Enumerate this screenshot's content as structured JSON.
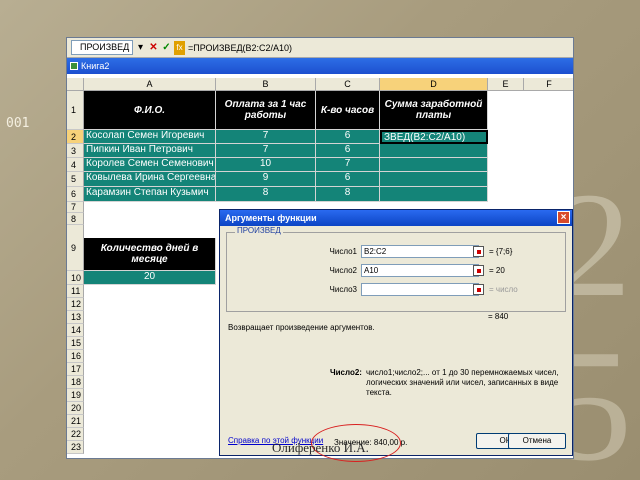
{
  "slide": {
    "number": "001",
    "author": "Олиференко И.А."
  },
  "formula_bar": {
    "name_box": "ПРОИЗВЕД",
    "cancel_icon": "x-icon",
    "enter_icon": "check-icon",
    "fx_icon": "fx-icon",
    "formula": "=ПРОИЗВЕД(B2:C2/A10)"
  },
  "workbook": {
    "title": "Книга2"
  },
  "columns": [
    "A",
    "B",
    "C",
    "D",
    "E",
    "F"
  ],
  "rows": [
    "1",
    "2",
    "3",
    "4",
    "5",
    "6",
    "7",
    "8",
    "9",
    "10",
    "11",
    "12",
    "13",
    "14",
    "15",
    "16",
    "17",
    "18",
    "19",
    "20",
    "21",
    "22",
    "23"
  ],
  "table": {
    "headers": [
      "Ф.И.О.",
      "Оплата за 1 час работы",
      "К-во часов",
      "Сумма заработной платы"
    ],
    "records": [
      {
        "name": "Косолап Семен Игоревич",
        "rate": "7",
        "hours": "6"
      },
      {
        "name": "Пипкин Иван Петрович",
        "rate": "7",
        "hours": "6"
      },
      {
        "name": "Королев Семен Семенович",
        "rate": "10",
        "hours": "7"
      },
      {
        "name": "Ковылева Ирина Сергеевна",
        "rate": "9",
        "hours": "6"
      },
      {
        "name": "Карамзин Степан Кузьмич",
        "rate": "8",
        "hours": "8"
      }
    ],
    "active_cell_text": "ЗВЕД(B2:C2/A10)",
    "days_header": "Количество дней в месяце",
    "days_value": "20"
  },
  "dialog": {
    "title": "Аргументы функции",
    "group_label": "ПРОИЗВЕД",
    "args": [
      {
        "label": "Число1",
        "value": "B2:C2",
        "result": "= {7;6}"
      },
      {
        "label": "Число2",
        "value": "A10",
        "result": "= 20"
      },
      {
        "label": "Число3",
        "value": "",
        "result": "= число"
      }
    ],
    "total_result": "= 840",
    "description": "Возвращает произведение аргументов.",
    "arg_help_title": "Число2:",
    "arg_help_text": "число1;число2;... от 1 до 30 перемножаемых чисел, логических значений или чисел, записанных в виде текста.",
    "help_link": "Справка по этой функции",
    "value_label": "Значение: 840,00 р.",
    "ok_label": "ОК",
    "cancel_label": "Отмена"
  }
}
